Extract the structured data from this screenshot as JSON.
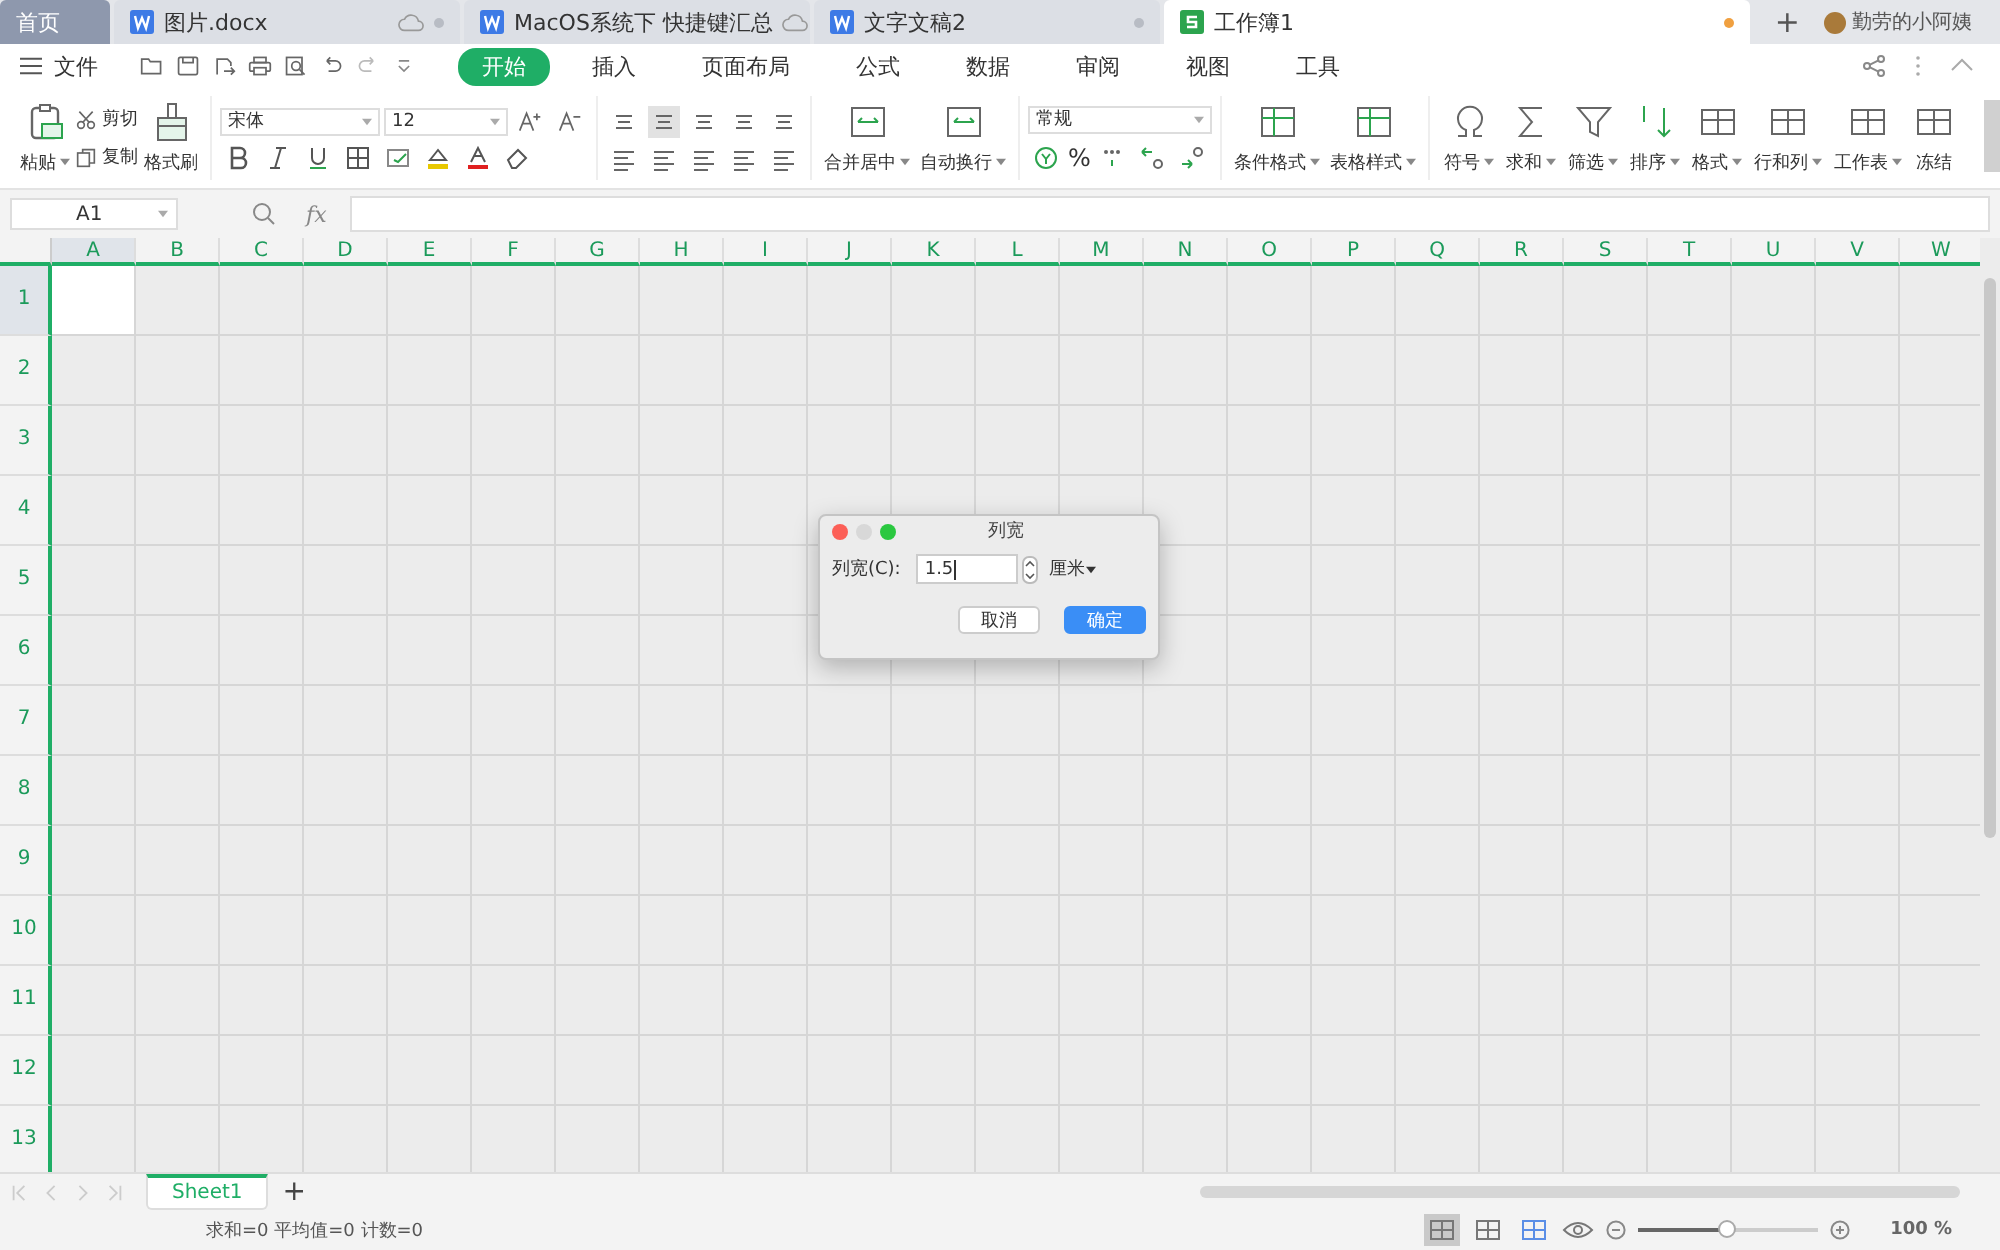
{
  "tabs": [
    {
      "label": "首页",
      "kind": "home",
      "selected": false,
      "cloud": false,
      "dot": false
    },
    {
      "label": "图片.docx",
      "kind": "doc",
      "selected": false,
      "cloud": true,
      "dot": true
    },
    {
      "label": "MacOS系统下 快捷键汇总",
      "kind": "doc",
      "selected": false,
      "cloud": true,
      "dot": false
    },
    {
      "label": "文字文稿2",
      "kind": "doc",
      "selected": false,
      "cloud": false,
      "dot": true
    },
    {
      "label": "工作簿1",
      "kind": "sheet",
      "selected": true,
      "cloud": false,
      "dot": true
    }
  ],
  "new_tab": "+",
  "user": "勤劳的小阿姨",
  "file_menu": "文件",
  "ribbon_tabs": [
    {
      "label": "开始",
      "selected": true
    },
    {
      "label": "插入",
      "selected": false
    },
    {
      "label": "页面布局",
      "selected": false
    },
    {
      "label": "公式",
      "selected": false
    },
    {
      "label": "数据",
      "selected": false
    },
    {
      "label": "审阅",
      "selected": false
    },
    {
      "label": "视图",
      "selected": false
    },
    {
      "label": "工具",
      "selected": false
    }
  ],
  "clipboard": {
    "paste": "粘贴",
    "cut": "剪切",
    "copy": "复制",
    "painter": "格式刷"
  },
  "font": {
    "family": "宋体",
    "size": "12"
  },
  "number_format": {
    "value": "常规",
    "percent": "%"
  },
  "large_buttons": [
    {
      "label": "合并居中"
    },
    {
      "label": "自动换行"
    },
    {
      "label": "条件格式"
    },
    {
      "label": "表格样式"
    },
    {
      "label": "符号"
    },
    {
      "label": "求和"
    },
    {
      "label": "筛选"
    },
    {
      "label": "排序"
    },
    {
      "label": "格式"
    },
    {
      "label": "行和列"
    },
    {
      "label": "工作表"
    },
    {
      "label": "冻结"
    }
  ],
  "formula_bar": {
    "name_box": "A1",
    "fx": "fx"
  },
  "grid": {
    "columns": [
      {
        "label": "A",
        "selected": true
      },
      {
        "label": "B",
        "selected": false
      },
      {
        "label": "C",
        "selected": false
      },
      {
        "label": "D",
        "selected": false
      },
      {
        "label": "E",
        "selected": false
      },
      {
        "label": "F",
        "selected": false
      },
      {
        "label": "G",
        "selected": false
      },
      {
        "label": "H",
        "selected": false
      },
      {
        "label": "I",
        "selected": false
      },
      {
        "label": "J",
        "selected": false
      },
      {
        "label": "K",
        "selected": false
      },
      {
        "label": "L",
        "selected": false
      },
      {
        "label": "M",
        "selected": false
      },
      {
        "label": "N",
        "selected": false
      },
      {
        "label": "O",
        "selected": false
      },
      {
        "label": "P",
        "selected": false
      },
      {
        "label": "Q",
        "selected": false
      },
      {
        "label": "R",
        "selected": false
      },
      {
        "label": "S",
        "selected": false
      },
      {
        "label": "T",
        "selected": false
      },
      {
        "label": "U",
        "selected": false
      },
      {
        "label": "V",
        "selected": false
      },
      {
        "label": "W",
        "selected": false
      }
    ],
    "rows": [
      {
        "label": "1",
        "selected": true
      },
      {
        "label": "2",
        "selected": false
      },
      {
        "label": "3",
        "selected": false
      },
      {
        "label": "4",
        "selected": false
      },
      {
        "label": "5",
        "selected": false
      },
      {
        "label": "6",
        "selected": false
      },
      {
        "label": "7",
        "selected": false
      },
      {
        "label": "8",
        "selected": false
      },
      {
        "label": "9",
        "selected": false
      },
      {
        "label": "10",
        "selected": false
      },
      {
        "label": "11",
        "selected": false
      },
      {
        "label": "12",
        "selected": false
      },
      {
        "label": "13",
        "selected": false
      }
    ]
  },
  "dialog": {
    "title": "列宽",
    "label": "列宽(C):",
    "value": "1.5",
    "unit": "厘米",
    "buttons": [
      {
        "label": "取消",
        "kind": "secondary"
      },
      {
        "label": "确定",
        "kind": "primary"
      }
    ]
  },
  "sheet_tabs": [
    {
      "label": "Sheet1",
      "selected": true
    }
  ],
  "add_sheet": "+",
  "status": {
    "summary": "求和=0 平均值=0 计数=0",
    "view_modes": [
      {
        "selected": true
      },
      {
        "selected": false
      },
      {
        "selected": false
      }
    ],
    "zoom": {
      "level": 0.5,
      "reading": "100 %"
    }
  }
}
